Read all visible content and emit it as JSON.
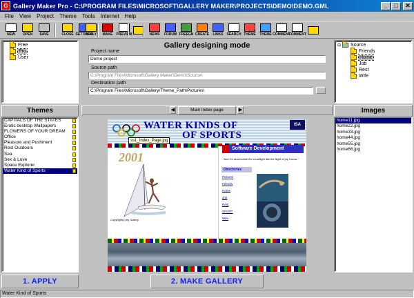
{
  "window": {
    "title": "Gallery Maker Pro - C:\\PROGRAM FILES\\MICROSOFT\\GALLERY MAKER\\PROJECTS\\DEMO\\DEMO.GML",
    "icon_letter": "G",
    "minimize": "_",
    "maximize": "□",
    "close": "✕"
  },
  "menu": [
    "File",
    "View",
    "Project",
    "Theme",
    "Tools",
    "Internet",
    "Help"
  ],
  "toolbar": {
    "buttons": [
      {
        "label": "NEW",
        "icon": "new-icon",
        "color": "#ffffff"
      },
      {
        "label": "OPEN",
        "icon": "open-folder-icon",
        "color": "#ffd800"
      },
      {
        "label": "SAVE",
        "icon": "save-icon",
        "color": "#c0c0c0"
      },
      {
        "label": "CLOSE",
        "icon": "close-folder-icon",
        "color": "#ffd800"
      },
      {
        "label": "SETTINGS",
        "icon": "settings-icon",
        "color": "#4060ff"
      },
      {
        "label": "APPLY",
        "icon": "apply-icon",
        "color": "#ffd800"
      },
      {
        "label": "MAKE",
        "icon": "make-arrow-icon",
        "color": "#e00000"
      },
      {
        "label": "PREVIEW",
        "icon": "preview-icon",
        "color": "#ffffff"
      },
      {
        "label": "",
        "icon": "help-icon",
        "color": "#ffd800"
      },
      {
        "label": "NEWS",
        "icon": "news-icon",
        "color": "#ff4040"
      },
      {
        "label": "FORUM",
        "icon": "forum-icon",
        "color": "#4060ff"
      },
      {
        "label": "FREEGN",
        "icon": "freegn-icon",
        "color": "#40a040"
      },
      {
        "label": "CREATE",
        "icon": "create-icon",
        "color": "#ff8000"
      },
      {
        "label": "LINKS",
        "icon": "links-icon",
        "color": "#4060ff"
      },
      {
        "label": "SEARCH",
        "icon": "search-icon",
        "color": "#ffffff"
      },
      {
        "label": "THEME",
        "icon": "theme-icon",
        "color": "#ff4040"
      },
      {
        "label": "THEME",
        "icon": "theme2-icon",
        "color": "#40a0ff"
      },
      {
        "label": "COMMENT",
        "icon": "comment-icon",
        "color": "#ffffff"
      },
      {
        "label": "COMMENT",
        "icon": "comment2-icon",
        "color": "#ffffff"
      },
      {
        "label": "",
        "icon": "brush-icon",
        "color": "#ffd800"
      }
    ]
  },
  "left_tree": {
    "items": [
      "Free",
      "Pro",
      "User"
    ],
    "selected": "Pro"
  },
  "designer": {
    "title": "Gallery designing mode",
    "project_name_label": "Project name",
    "project_name": "Demo project",
    "source_path_label": "Source path",
    "source_path": "C:\\Program Files\\Microsoft\\Gallery Maker\\Demo\\Source\\",
    "dest_path_label": "Destination path",
    "dest_path": "C:\\Program Files\\Microsoft\\Gallery\\Theme_Path\\Pictures\\",
    "browse": "..."
  },
  "right_tree": {
    "root": "Source",
    "items": [
      "Friends",
      "Home",
      "Job",
      "Rest",
      "Wife"
    ],
    "selected": "Home"
  },
  "themes": {
    "header": "Themes",
    "items": [
      "CAPITALS OF THE STATES",
      "Erotic desktop Wallpapers",
      "FLOWERS OF YOUR DREAM",
      "Office",
      "Pleasure and Pushment",
      "Rest Outdoors",
      "Sea",
      "Sex & Love",
      "Space Explorer",
      "Water Kind of Sports"
    ],
    "selected": "Water Kind of Sports"
  },
  "images": {
    "header": "Images",
    "items": [
      "home11.jpg",
      "home22.jpg",
      "home33.jpg",
      "home44.jpg",
      "home55.jpg",
      "home66.jpg"
    ],
    "selected": "home11.jpg"
  },
  "nav": {
    "prev": "◀",
    "page": "Main index page",
    "next": "▶"
  },
  "preview": {
    "title_line1": "WATER KINDS OF",
    "title_line2": "OF SPORTS",
    "tooltip": "ss1_Index_Page.jpg",
    "year": "2001",
    "isa": "ISA",
    "software_dev": "Software Development",
    "tagline": "\" And I'm underneath the crowflight like the flight of joy I know \"",
    "directories": "Directories",
    "links": [
      "Pictures",
      "Friends",
      "Home",
      "Job",
      "Rest",
      "SPORT",
      "Wife"
    ],
    "caption": "Copyright(c) by Gallery"
  },
  "buttons": {
    "apply": "1. APPLY",
    "make": "2. MAKE GALLERY"
  },
  "status": "Water Kind of Sports"
}
